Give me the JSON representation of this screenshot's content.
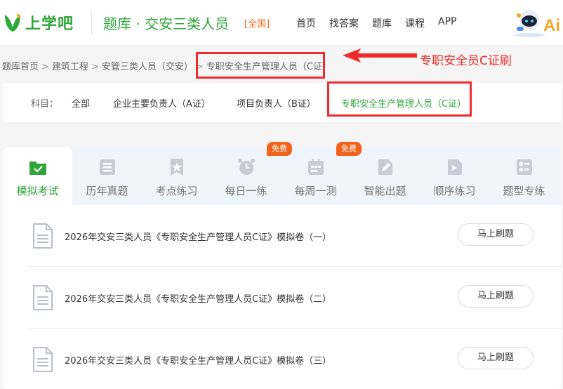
{
  "header": {
    "logo_text": "上学吧",
    "site_title": "题库 · 交安三类人员",
    "region": "[全国]",
    "nav": [
      "首页",
      "找答案",
      "题库",
      "课程",
      "APP"
    ]
  },
  "breadcrumb": [
    "题库首页",
    "建筑工程",
    "安管三类人员（交安）",
    "专职安全生产管理人员（C证）"
  ],
  "annotation": "专职安全员C证刷",
  "subjects": {
    "label": "科目：",
    "options": [
      "全部",
      "企业主要负责人（A证）",
      "项目负责人（B证）",
      "专职安全生产管理人员（C证）"
    ],
    "selected": "专职安全生产管理人员（C证）"
  },
  "tabs": [
    {
      "label": "模拟考试",
      "icon": "check-folder-icon"
    },
    {
      "label": "历年真题",
      "icon": "stack-icon"
    },
    {
      "label": "考点练习",
      "icon": "star-bookmark-icon"
    },
    {
      "label": "每日一练",
      "icon": "alarm-clock-icon"
    },
    {
      "label": "每周一测",
      "icon": "calendar-icon",
      "badge": "免费"
    },
    {
      "label": "智能出题",
      "icon": "pencil-icon",
      "badge": "免费"
    },
    {
      "label": "顺序练习",
      "icon": "play-list-icon"
    },
    {
      "label": "题型专练",
      "icon": "grid-list-icon"
    }
  ],
  "active_tab": "模拟考试",
  "papers": [
    {
      "title": "2026年交安三类人员《专职安全生产管理人员C证》模拟卷（一）",
      "action": "马上刷题"
    },
    {
      "title": "2026年交安三类人员《专职安全生产管理人员C证》模拟卷（二）",
      "action": "马上刷题"
    },
    {
      "title": "2026年交安三类人员《专职安全生产管理人员C证》模拟卷（三）",
      "action": "马上刷题"
    }
  ],
  "colors": {
    "brand_green": "#2ea63a",
    "accent_orange": "#f3621a",
    "annotation_red": "#ef2b2b"
  }
}
